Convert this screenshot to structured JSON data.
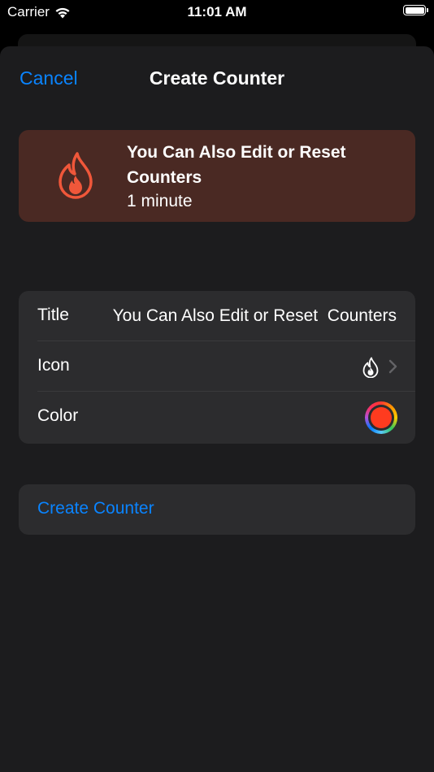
{
  "status_bar": {
    "carrier": "Carrier",
    "time": "11:01 AM",
    "wifi_icon": "wifi-icon",
    "battery_icon": "battery-icon"
  },
  "nav": {
    "cancel_label": "Cancel",
    "title": "Create Counter"
  },
  "preview": {
    "icon": "flame-icon",
    "title": "You Can Also Edit or Reset  Counters",
    "subtitle": "1 minute",
    "background_color": "#4a2923",
    "icon_color": "#f0573a"
  },
  "form": {
    "title_label": "Title",
    "title_value": "You Can Also Edit or Reset  Counters",
    "icon_label": "Icon",
    "icon_value": "flame-icon",
    "color_label": "Color",
    "color_value": "#ff3b1f"
  },
  "create_button": {
    "label": "Create Counter"
  },
  "colors": {
    "accent": "#0a84ff",
    "sheet_background": "#1c1c1e",
    "group_background": "#2c2c2e"
  }
}
